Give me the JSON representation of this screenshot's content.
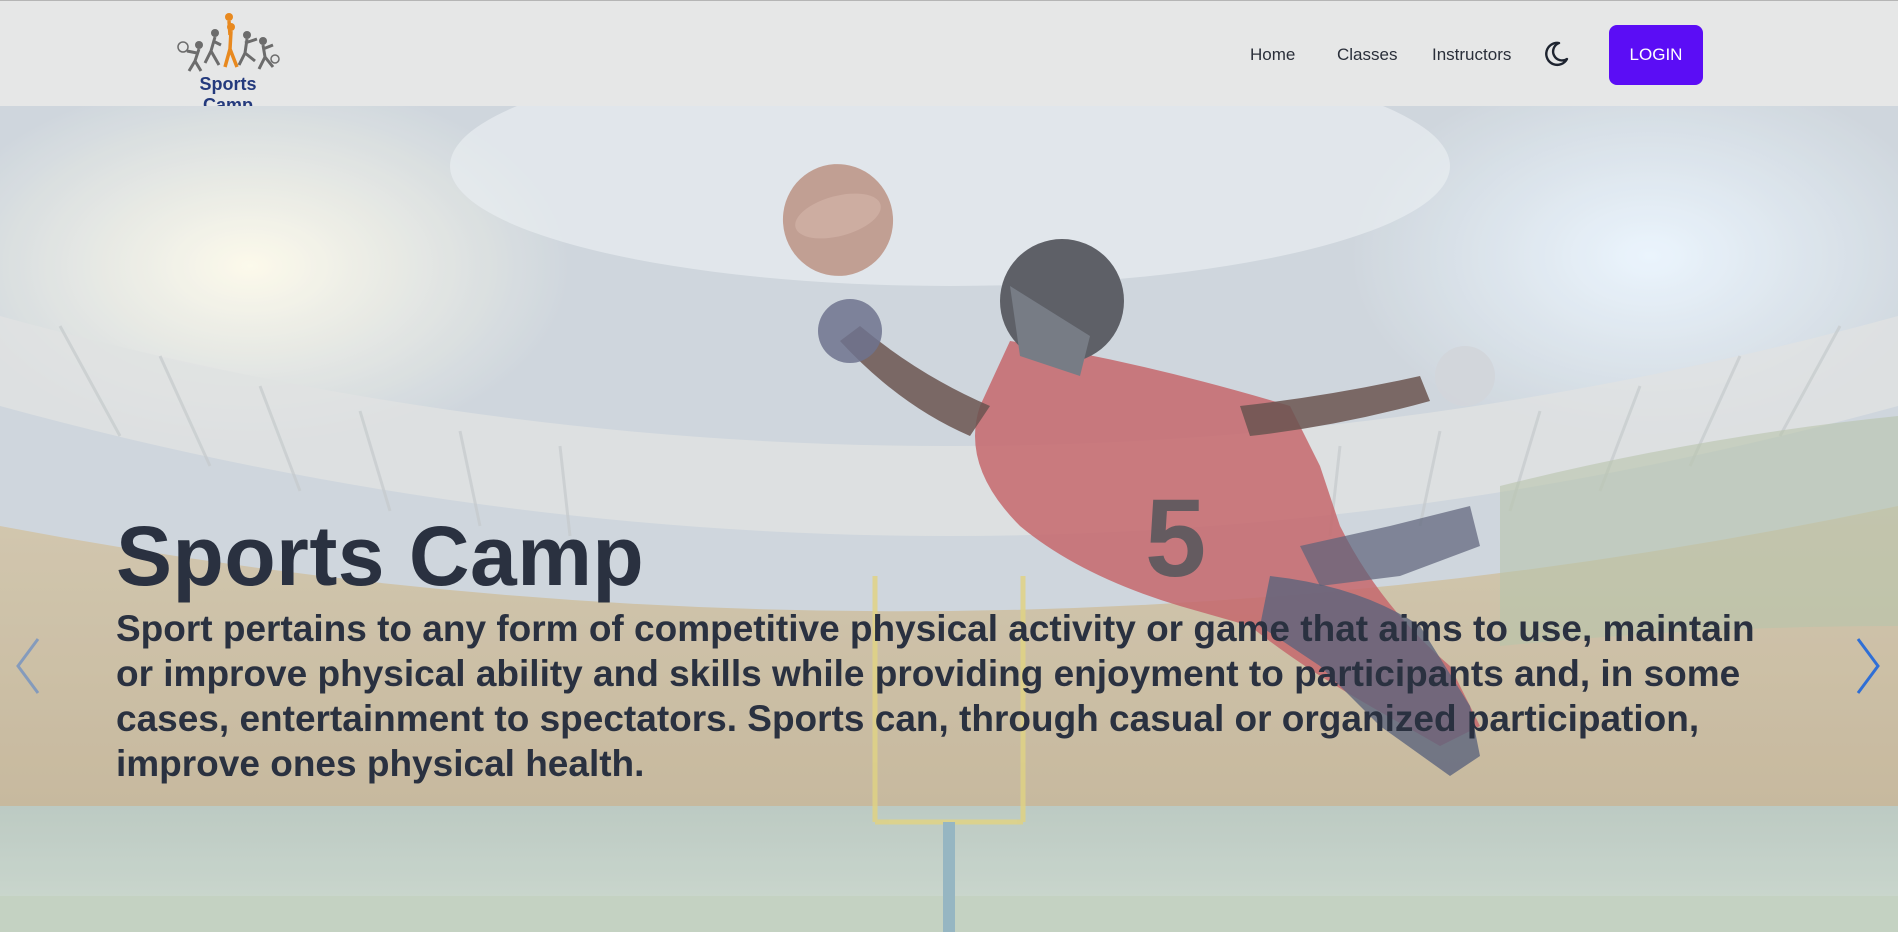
{
  "brand": {
    "name": "Sports Camp",
    "logo_icon": "sports-figures-logo"
  },
  "nav": {
    "links": [
      {
        "label": "Home"
      },
      {
        "label": "Classes"
      },
      {
        "label": "Instructors"
      }
    ],
    "theme_toggle_icon": "moon-icon",
    "login_label": "LOGIN"
  },
  "hero": {
    "title": "Sports Camp",
    "description": "Sport pertains to any form of competitive physical activity or game that aims to use, maintain or improve physical ability and skills while providing enjoyment to participants and, in some cases, entertainment to spectators. Sports can, through casual or organized participation, improve ones physical health.",
    "prev_icon": "chevron-left-icon",
    "next_icon": "chevron-right-icon"
  },
  "colors": {
    "accent": "#5b0df5",
    "nav_bg": "#e6e7e7",
    "text_dark": "#2a3140",
    "arrow": "#2f6fd6",
    "brand_text": "#243a7d"
  }
}
